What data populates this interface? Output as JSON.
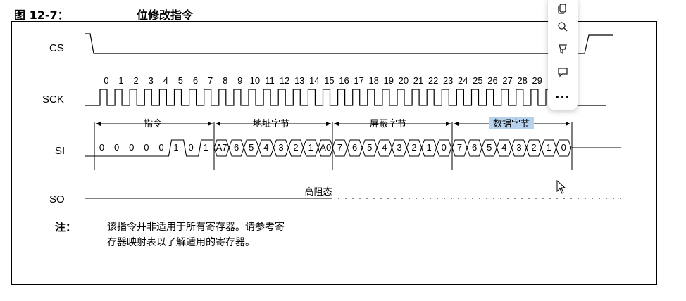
{
  "figure": {
    "number": "图 12-7：",
    "title": "位修改指令"
  },
  "signals": {
    "cs": "CS",
    "sck": "SCK",
    "si": "SI",
    "so": "SO"
  },
  "clock_numbers": [
    "0",
    "1",
    "2",
    "3",
    "4",
    "5",
    "6",
    "7",
    "8",
    "9",
    "10",
    "11",
    "12",
    "13",
    "14",
    "15",
    "16",
    "17",
    "18",
    "19",
    "20",
    "21",
    "22",
    "23",
    "24",
    "25",
    "26",
    "27",
    "28",
    "29"
  ],
  "segments": {
    "instruction": "指令",
    "address": "地址字节",
    "mask": "屏蔽字节",
    "data": "数据字节"
  },
  "si_bits": {
    "instruction": [
      "0",
      "0",
      "0",
      "0",
      "0",
      "1",
      "0",
      "1"
    ],
    "address": [
      "A7",
      "6",
      "5",
      "4",
      "3",
      "2",
      "1",
      "A0"
    ],
    "mask": [
      "7",
      "6",
      "5",
      "4",
      "3",
      "2",
      "1",
      "0"
    ],
    "data": [
      "7",
      "6",
      "5",
      "4",
      "3",
      "2",
      "1",
      "0"
    ]
  },
  "so_label": "高阻态",
  "note": {
    "label": "注：",
    "line1": "该指令并非适用于所有寄存器。请参考寄",
    "line2": "存器映射表以了解适用的寄存器。"
  },
  "toolbar": {
    "icons": [
      "copy-icon",
      "search-icon",
      "highlight-icon",
      "comment-icon",
      "more-icon"
    ],
    "more_label": "..."
  },
  "colors": {
    "highlight": "#b6d2ec",
    "line": "#000000"
  }
}
